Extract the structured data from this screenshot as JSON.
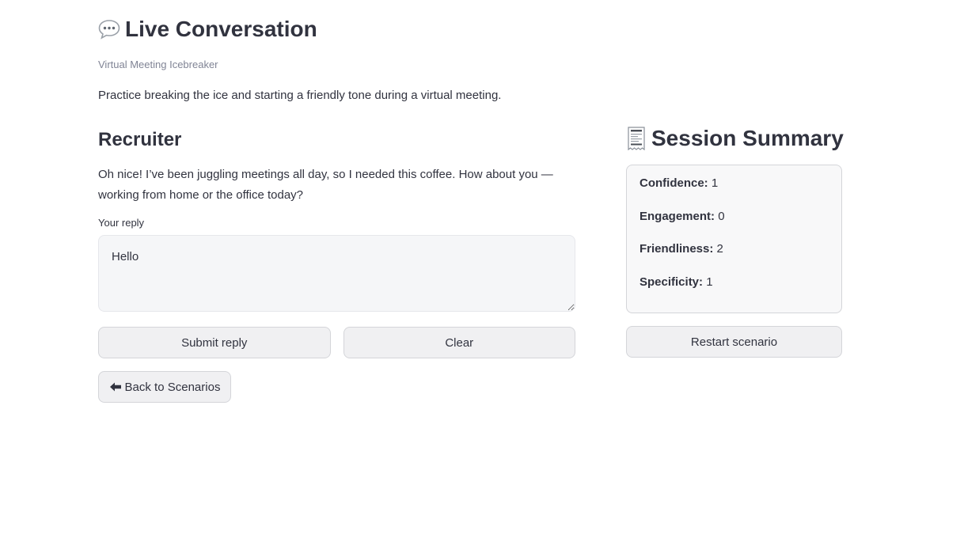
{
  "header": {
    "title": "Live Conversation",
    "title_icon": "speech-bubble-icon",
    "subtitle": "Virtual Meeting Icebreaker",
    "description": "Practice breaking the ice and starting a friendly tone during a virtual meeting."
  },
  "conversation": {
    "speaker": "Recruiter",
    "message": "Oh nice! I’ve been juggling meetings all day, so I needed this coffee. How about you — working from home or the office today?",
    "reply_label": "Your reply",
    "reply_value": "Hello",
    "submit_label": "Submit reply",
    "clear_label": "Clear",
    "back_label": "Back to Scenarios",
    "back_icon": "left-arrow-icon"
  },
  "summary": {
    "title": "Session Summary",
    "title_icon": "receipt-icon",
    "metrics": [
      {
        "label": "Confidence:",
        "value": "1"
      },
      {
        "label": "Engagement:",
        "value": "0"
      },
      {
        "label": "Friendliness:",
        "value": "2"
      },
      {
        "label": "Specificity:",
        "value": "1"
      }
    ],
    "restart_label": "Restart scenario"
  }
}
